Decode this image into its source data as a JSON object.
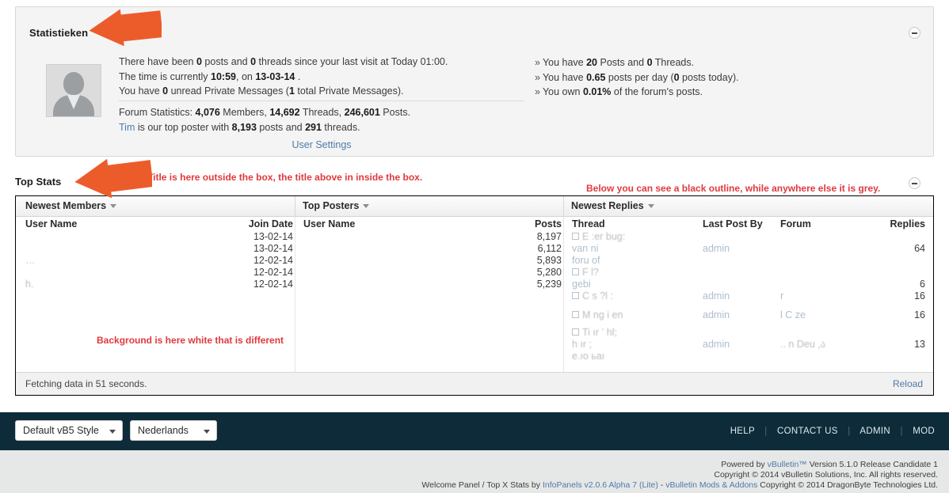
{
  "stats_panel": {
    "title": "Statistieken",
    "collapse_icon": "minus-circle-icon",
    "avatar_icon": "default-avatar-icon",
    "left": {
      "line1_a": "There have been ",
      "line1_b": "0",
      "line1_c": " posts and ",
      "line1_d": "0",
      "line1_e": " threads since your last visit at Today 01:00.",
      "line2_a": "The time is currently ",
      "line2_b": "10:59",
      "line2_c": ", on ",
      "line2_d": "13-03-14",
      "line2_e": " .",
      "line3_a": "You have ",
      "line3_b": "0",
      "line3_c": " unread Private Messages (",
      "line3_d": "1",
      "line3_e": " total Private Messages).",
      "forum_a": "Forum Statistics: ",
      "forum_members": "4,076",
      "forum_b": " Members, ",
      "forum_threads": "14,692",
      "forum_c": " Threads, ",
      "forum_posts": "246,601",
      "forum_d": " Posts.",
      "top_poster_name": "Tim",
      "top_poster_a": " is our top poster with ",
      "top_poster_posts": "8,193",
      "top_poster_b": " posts and ",
      "top_poster_threads": "291",
      "top_poster_c": " threads.",
      "user_settings_link": "User Settings"
    },
    "right": {
      "bullet": "»",
      "r1_a": "You have ",
      "r1_b": "20",
      "r1_c": " Posts and ",
      "r1_d": "0",
      "r1_e": " Threads.",
      "r2_a": "You have ",
      "r2_b": "0.65",
      "r2_c": " posts per day (",
      "r2_d": "0",
      "r2_e": " posts today).",
      "r3_a": "You own ",
      "r3_b": "0.01%",
      "r3_c": " of the forum's posts."
    }
  },
  "top_stats": {
    "title": "Top Stats",
    "collapse_icon": "minus-circle-icon",
    "tabs": [
      {
        "label": "Newest Members",
        "caret": "caret-down-icon"
      },
      {
        "label": "Top Posters",
        "caret": "caret-down-icon"
      },
      {
        "label": "Newest Replies",
        "caret": "caret-down-icon"
      }
    ],
    "newest_members": {
      "col_user": "User Name",
      "col_date": "Join Date",
      "rows": [
        {
          "user": "",
          "date": "13-02-14"
        },
        {
          "user": "",
          "date": "13-02-14"
        },
        {
          "user": "…",
          "date": "12-02-14"
        },
        {
          "user": "",
          "date": "12-02-14"
        },
        {
          "user": "h.",
          "date": "12-02-14"
        }
      ]
    },
    "top_posters": {
      "col_user": "User Name",
      "col_posts": "Posts",
      "rows": [
        {
          "user": "",
          "posts": "8,197"
        },
        {
          "user": "",
          "posts": "6,112"
        },
        {
          "user": "",
          "posts": "5,893"
        },
        {
          "user": "",
          "posts": "5,280"
        },
        {
          "user": "",
          "posts": "5,239"
        }
      ]
    },
    "newest_replies": {
      "col_thread": "Thread",
      "col_lastpost": "Last Post By",
      "col_forum": "Forum",
      "col_replies": "Replies",
      "rows": [
        {
          "thread_l1": "E     :er    bug:",
          "thread_l2": "van    ni",
          "thread_l3": "foru   of",
          "last_post": "admin",
          "forum": "",
          "replies": "64"
        },
        {
          "thread_l1": "F    l?",
          "thread_l2": "gebi",
          "thread_l3": "",
          "last_post": "",
          "forum": "",
          "replies": "6"
        },
        {
          "thread_l1": "C     s    ?l   :",
          "thread_l2": "",
          "thread_l3": "",
          "last_post": "admin",
          "forum": "r",
          "replies": "16"
        },
        {
          "thread_l1": "M     ng       i    en",
          "thread_l2": "",
          "thread_l3": "",
          "last_post": "admin",
          "forum": "l  C            ze",
          "replies": "16"
        },
        {
          "thread_l1": "Ti    ır    ʻ      hl;",
          "thread_l2": "h              ır        ;",
          "thread_l3": "e.ıo      ьaı",
          "last_post": "admin",
          "forum": "..          n   Deu      ,ა",
          "replies": "13"
        }
      ]
    },
    "status": "Fetching data in 51 seconds.",
    "reload": "Reload"
  },
  "annotations": [
    {
      "text": "Title is here outside the box, the title above in inside the box."
    },
    {
      "text": "Below you can see a black outline, while anywhere else it is grey."
    },
    {
      "text": "Background is here white that is different"
    }
  ],
  "footer_bar": {
    "style_select": {
      "value": "Default vB5 Style",
      "caret": "caret-down-icon"
    },
    "language_select": {
      "value": "Nederlands",
      "caret": "caret-down-icon"
    },
    "nav": [
      {
        "label": "HELP"
      },
      {
        "label": "CONTACT US"
      },
      {
        "label": "ADMIN"
      },
      {
        "label": "MOD"
      }
    ],
    "separator": "|"
  },
  "copyright": {
    "l1_a": "Powered by ",
    "l1_link": "vBulletin™",
    "l1_b": " Version 5.1.0 Release Candidate 1",
    "l2": "Copyright © 2014 vBulletin Solutions, Inc. All rights reserved.",
    "l3_a": "Welcome Panel / Top X Stats by ",
    "l3_link1": "InfoPanels v2.0.6 Alpha 7 (Lite)",
    "l3_b": " - ",
    "l3_link2": "vBulletin Mods & Addons",
    "l3_c": " Copyright © 2014 DragonByte Technologies Ltd."
  },
  "colors": {
    "accent_link": "#4c7ba6",
    "annotation_red": "#e0393e",
    "arrow_orange": "#ec5c2b",
    "dark_bar": "#0d2b38",
    "panel_grey": "#f4f4f4"
  }
}
